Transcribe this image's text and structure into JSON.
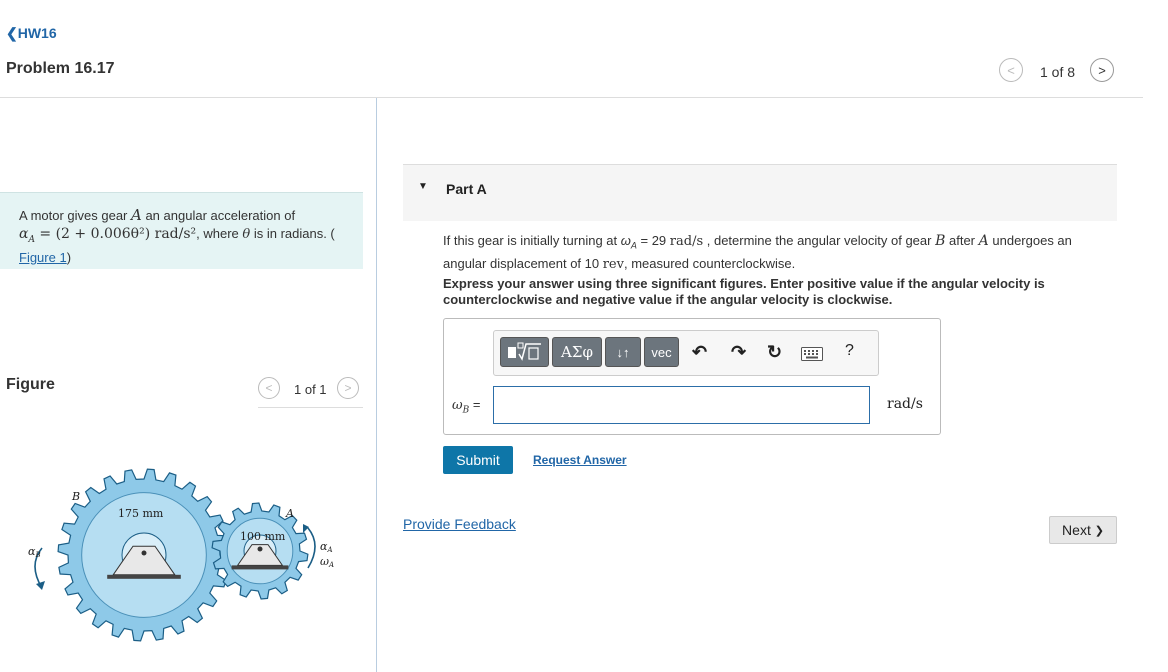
{
  "header": {
    "back_label": "HW16",
    "back_icon": "chevron-left-icon",
    "problem_title": "Problem 16.17",
    "pager": {
      "count": "1 of 8",
      "prev_glyph": "<",
      "next_glyph": ">"
    }
  },
  "statement": {
    "text_1": "A motor gives gear ",
    "gear_a": "A",
    "text_2": " an angular acceleration of",
    "alpha_eq": "α",
    "alpha_sub": "A",
    "equation": " = (2 + 0.006θ²) rad/s²",
    "text_3": ", where ",
    "theta": "θ",
    "text_4": " is in radians. (",
    "figure_link": "Figure 1",
    "close_paren": ")"
  },
  "figure": {
    "title": "Figure",
    "count": "1 of 1",
    "prev_glyph": "<",
    "next_glyph": ">",
    "labels": {
      "gear_b": "B",
      "gear_a": "A",
      "radius_b": "175 mm",
      "radius_a": "100 mm",
      "alpha_b": "α",
      "alpha_b_sub": "B",
      "alpha_a": "α",
      "alpha_a_sub": "A",
      "omega_a": "ω",
      "omega_a_sub": "A"
    }
  },
  "partA": {
    "caret": "▼",
    "title": "Part A",
    "q_1": "If this gear is initially turning at ",
    "q_omega": "ω",
    "q_omega_sub": "A",
    "q_2": " = 29 ",
    "q_unit": "rad/s",
    "q_3": " , determine the angular velocity of gear ",
    "q_gear_b": "B",
    "q_4": " after ",
    "q_gear_a": "A",
    "q_5": " undergoes an angular displacement of 10 ",
    "q_rev": "rev",
    "q_6": ", measured counterclockwise.",
    "instruction": "Express your answer using three significant figures. Enter positive value if the angular velocity is counterclockwise and negative value if the angular velocity is clockwise."
  },
  "toolbar": {
    "templates_icon": "templates-icon",
    "greek_label": "ΑΣφ",
    "arrows_label": "↓↑",
    "vec_label": "vec",
    "undo_glyph": "↶",
    "redo_glyph": "↷",
    "reset_glyph": "↻",
    "keyboard_icon": "keyboard-icon",
    "help_label": "?"
  },
  "answer": {
    "label_omega": "ω",
    "label_sub": "B",
    "label_eq": " =",
    "value": "",
    "unit": "rad/s"
  },
  "actions": {
    "submit_label": "Submit",
    "request_answer_label": "Request Answer",
    "feedback_label": "Provide Feedback",
    "next_label": "Next",
    "next_glyph": "❯"
  },
  "colors": {
    "link": "#2166a7",
    "statement_bg": "#e5f4f4",
    "submit_bg": "#0e76a8",
    "gear_fill": "#8ec9e8",
    "gear_stroke": "#1b5e86"
  }
}
